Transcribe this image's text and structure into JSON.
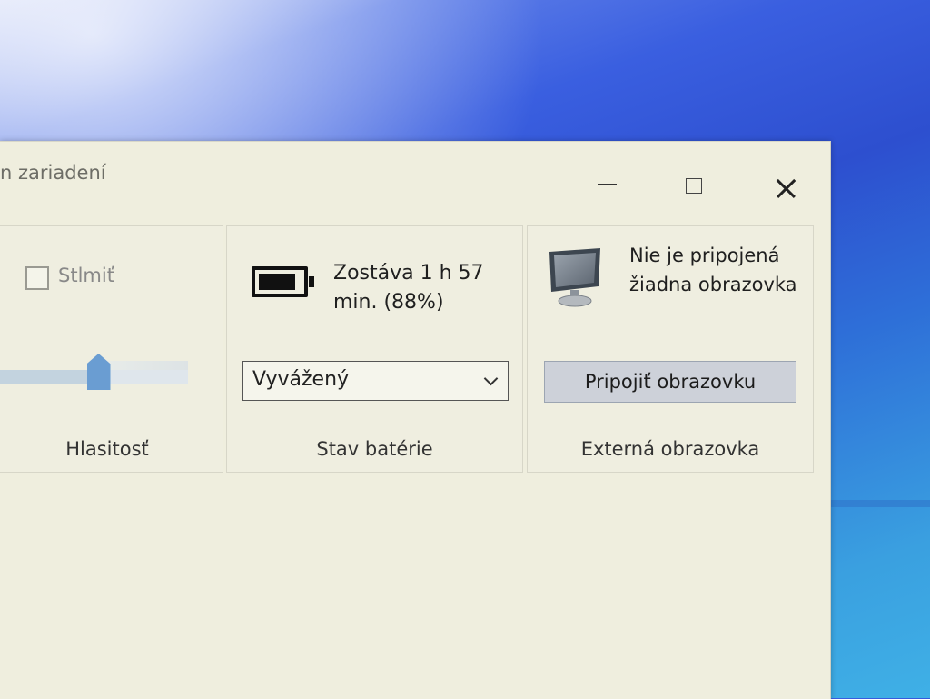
{
  "window": {
    "title": "n zariadení",
    "controls": {
      "minimize": "minimize-icon",
      "maximize": "maximize-icon",
      "close": "close-icon"
    }
  },
  "volume": {
    "mute_label": "Stlmiť",
    "mute_checked": false,
    "level_fraction": 0.55,
    "footer": "Hlasitosť"
  },
  "battery": {
    "status": "Zostáva 1 h 57 min. (88%)",
    "percent": 88,
    "icon": "battery-icon",
    "power_plan": "Vyvážený",
    "footer": "Stav batérie"
  },
  "display": {
    "status": "Nie je pripojená žiadna obrazovka",
    "icon": "monitor-icon",
    "connect_button": "Pripojiť obrazovku",
    "footer": "Externá obrazovka"
  },
  "colors": {
    "window_bg": "#efeede",
    "slider_thumb": "#6a9dd2",
    "button_bg": "#cdd1d9"
  }
}
